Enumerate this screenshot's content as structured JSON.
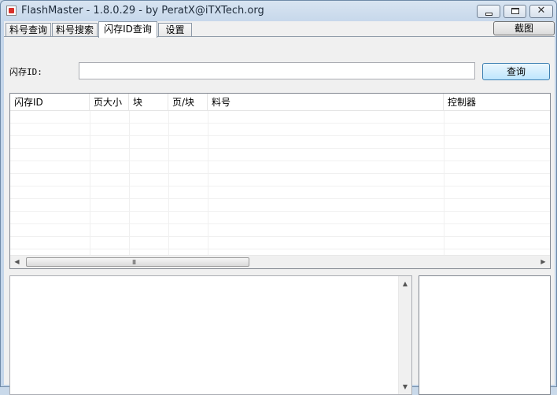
{
  "window": {
    "title": "FlashMaster - 1.8.0.29 - by PeratX@iTXTech.org",
    "icon": "app-icon",
    "controls": {
      "minimize": "minimize-icon",
      "maximize": "maximize-icon",
      "close": "close-icon"
    }
  },
  "tabs": [
    {
      "label": "料号查询",
      "active": false
    },
    {
      "label": "料号搜索",
      "active": false
    },
    {
      "label": "闪存ID查询",
      "active": true
    },
    {
      "label": "设置",
      "active": false
    }
  ],
  "toolbar": {
    "capture_label": "截图"
  },
  "search": {
    "label": "闪存ID:",
    "value": "",
    "button_label": "查询"
  },
  "table": {
    "columns": [
      "闪存ID",
      "页大小",
      "块",
      "页/块",
      "料号",
      "控制器"
    ],
    "rows": []
  },
  "scrollbar": {
    "left_arrow": "◀",
    "right_arrow": "▶",
    "up_arrow": "▲",
    "down_arrow": "▼",
    "grip": "III"
  },
  "log": {
    "text": ""
  },
  "details": {
    "text": ""
  }
}
